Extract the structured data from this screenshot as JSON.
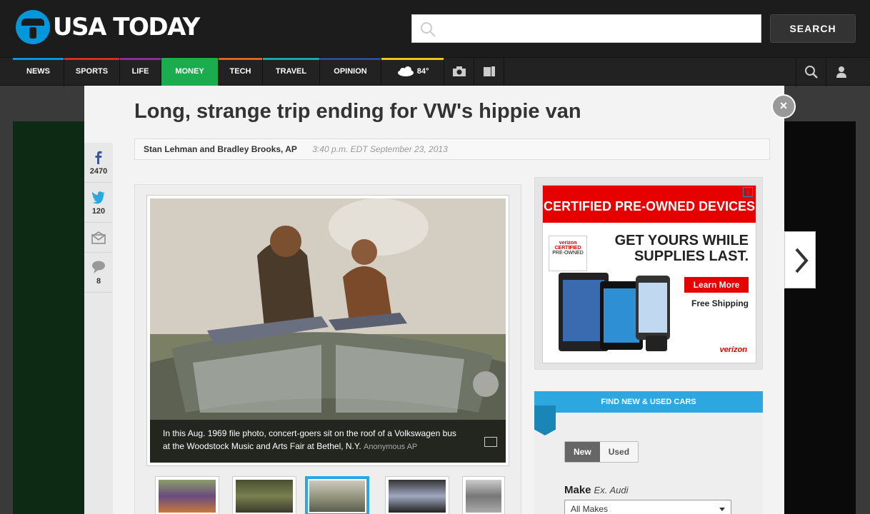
{
  "header": {
    "logo_text": "USA TODAY",
    "search_placeholder": "",
    "search_button": "SEARCH"
  },
  "nav": {
    "items": [
      {
        "label": "NEWS",
        "color": "#0098db"
      },
      {
        "label": "SPORTS",
        "color": "#d62d20"
      },
      {
        "label": "LIFE",
        "color": "#8e2e99"
      },
      {
        "label": "MONEY",
        "color": "#1aac4e"
      },
      {
        "label": "TECH",
        "color": "#e2611f"
      },
      {
        "label": "TRAVEL",
        "color": "#1aa9a9"
      },
      {
        "label": "OPINION",
        "color": "#2b4d8f"
      }
    ],
    "weather": "84°",
    "weather_bar_color": "#f0c419"
  },
  "article": {
    "title": "Long, strange trip ending for VW's hippie van",
    "author": "Stan Lehman and Bradley Brooks, AP",
    "timestamp": "3:40 p.m. EDT September 23, 2013"
  },
  "share": {
    "facebook_count": "2470",
    "twitter_count": "120",
    "comments_count": "8"
  },
  "photo": {
    "caption": "In this Aug. 1969 file photo, concert-goers sit on the roof of a Volkswagen bus at the Woodstock Music and Arts Fair at Bethel, N.Y.",
    "credit": "Anonymous AP"
  },
  "ad": {
    "top": "CERTIFIED PRE-OWNED DEVICES",
    "headline_1": "GET YOURS WHILE",
    "headline_2": "SUPPLIES LAST.",
    "cta": "Learn More",
    "shipping": "Free Shipping",
    "brand": "verizon",
    "badge_brand": "verizon",
    "badge_line1": "CERTIFIED",
    "badge_line2": "PRE-OWNED"
  },
  "cars": {
    "title": "FIND NEW & USED CARS",
    "toggle_new": "New",
    "toggle_used": "Used",
    "make_label": "Make",
    "make_example": "Ex. Audi",
    "make_select": "All Makes"
  },
  "close_label": "×"
}
